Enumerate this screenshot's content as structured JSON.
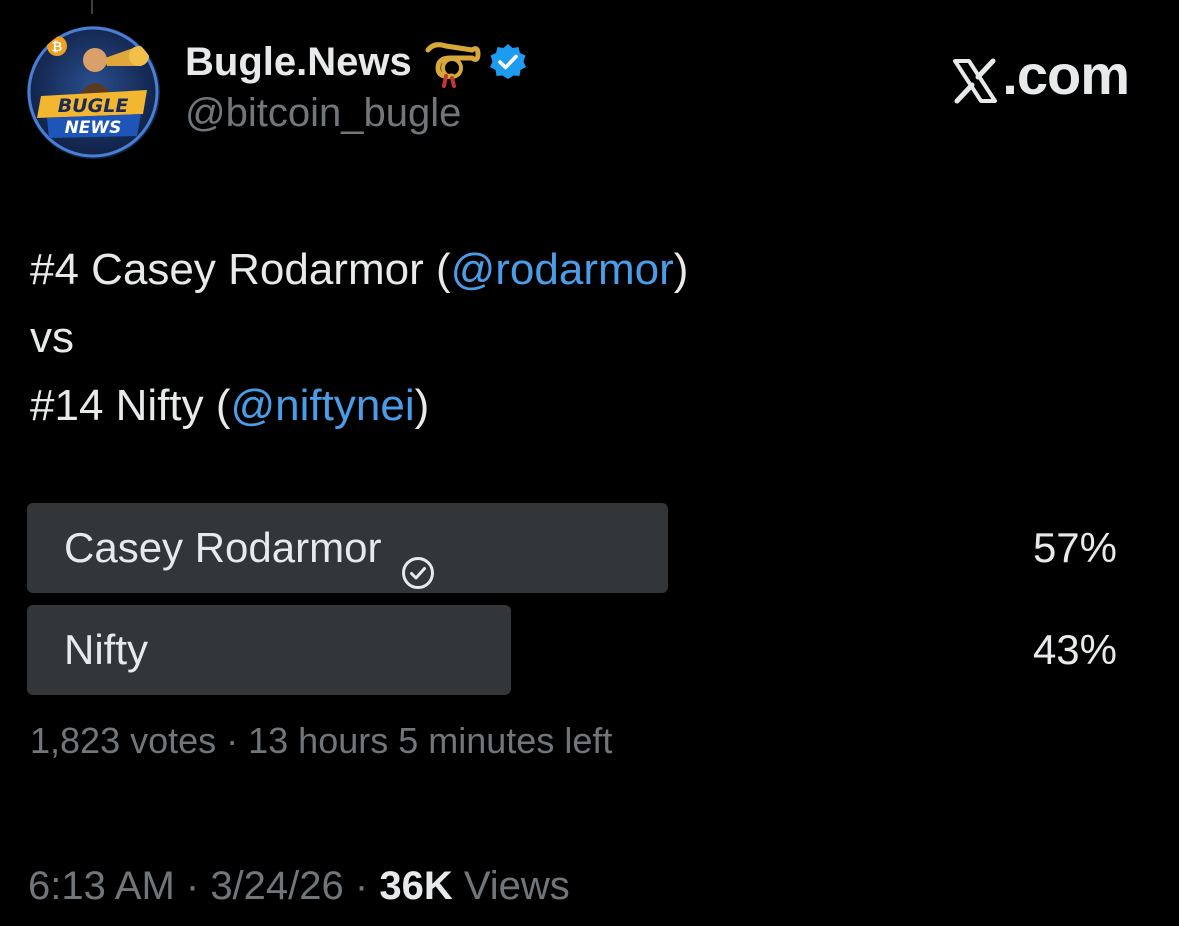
{
  "author": {
    "display_name": "Bugle.News",
    "handle": "@bitcoin_bugle",
    "avatar_text": [
      "BUGLE",
      "NEWS"
    ],
    "verified": true
  },
  "brand": {
    "label": ".com",
    "logo": "x-logo-icon"
  },
  "tweet": {
    "line1_prefix": "#4 Casey Rodarmor (",
    "line1_mention": "@rodarmor",
    "line1_suffix": ")",
    "line2": "vs",
    "line3_prefix": "#14 Nifty (",
    "line3_mention": "@niftynei",
    "line3_suffix": ")"
  },
  "poll": {
    "options": [
      {
        "label": "Casey Rodarmor",
        "percent_text": "57%",
        "fraction": 0.57,
        "winner": true
      },
      {
        "label": "Nifty",
        "percent_text": "43%",
        "fraction": 0.43,
        "winner": false
      }
    ],
    "votes": "1,823 votes",
    "separator": " · ",
    "time_left": "13 hours 5 minutes left"
  },
  "footer": {
    "time": "6:13 AM",
    "separator": " · ",
    "date": "3/24/26",
    "views_count": "36K",
    "views_label": " Views"
  },
  "colors": {
    "background": "#000000",
    "text": "#e7e9ea",
    "muted": "#71767b",
    "mention": "#4b9de8",
    "poll_bar": "#333639",
    "verified": "#1d9bf0"
  }
}
